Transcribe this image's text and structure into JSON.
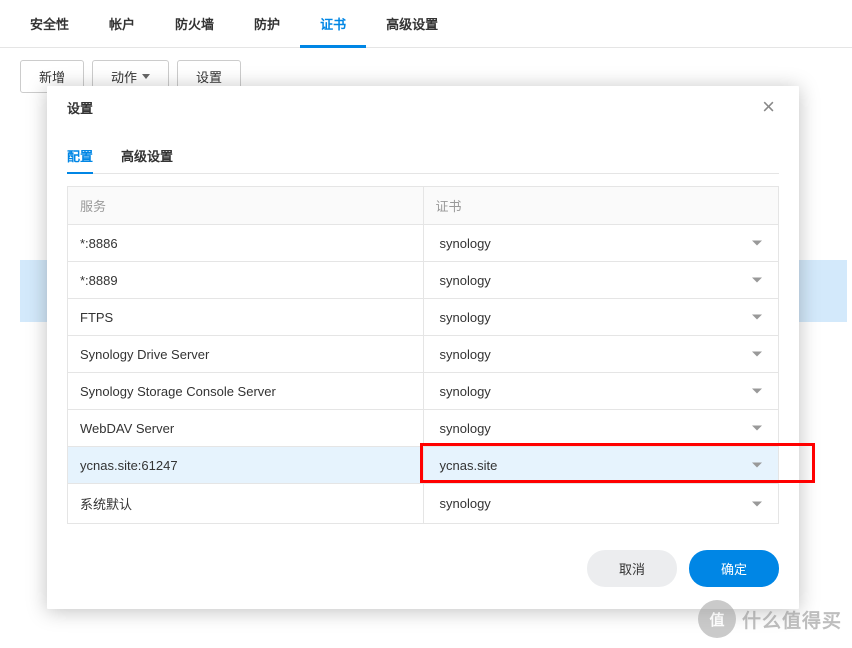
{
  "top_tabs": {
    "security": "安全性",
    "account": "帐户",
    "firewall": "防火墙",
    "protection": "防护",
    "certificate": "证书",
    "advanced": "高级设置"
  },
  "toolbar": {
    "new_label": "新增",
    "action_label": "动作",
    "settings_label": "设置"
  },
  "modal": {
    "title": "设置",
    "tabs": {
      "config": "配置",
      "advanced": "高级设置"
    },
    "table": {
      "header_service": "服务",
      "header_cert": "证书",
      "rows": [
        {
          "service": "*:8886",
          "cert": "synology"
        },
        {
          "service": "*:8889",
          "cert": "synology"
        },
        {
          "service": "FTPS",
          "cert": "synology"
        },
        {
          "service": "Synology Drive Server",
          "cert": "synology"
        },
        {
          "service": "Synology Storage Console Server",
          "cert": "synology"
        },
        {
          "service": "WebDAV Server",
          "cert": "synology"
        },
        {
          "service": "ycnas.site:61247",
          "cert": "ycnas.site"
        },
        {
          "service": "系统默认",
          "cert": "synology"
        }
      ]
    },
    "buttons": {
      "cancel": "取消",
      "ok": "确定"
    }
  },
  "watermark": {
    "circle": "值",
    "text": "什么值得买"
  }
}
